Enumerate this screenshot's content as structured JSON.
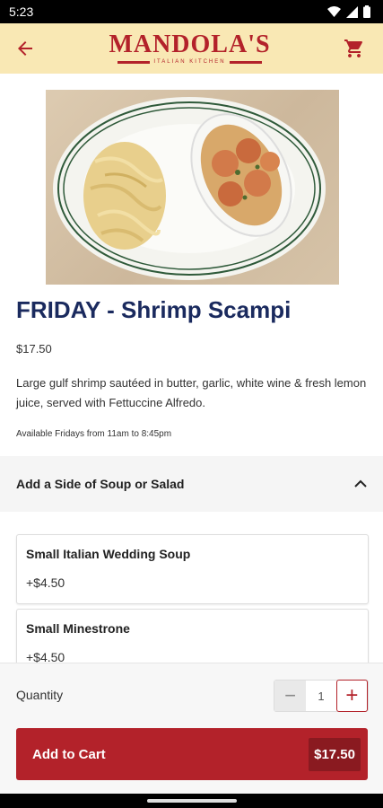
{
  "status_bar": {
    "time": "5:23"
  },
  "app_bar": {
    "brand_name": "MANDOLA'S",
    "brand_tagline": "ITALIAN KITCHEN",
    "back_icon": "arrow-left-icon",
    "cart_icon": "shopping-cart-icon"
  },
  "item": {
    "image_alt": "Shrimp scampi with fettuccine alfredo",
    "title": "FRIDAY - Shrimp Scampi",
    "price": "$17.50",
    "description": "Large gulf shrimp sautéed in butter, garlic, white wine & fresh lemon juice, served with Fettuccine Alfredo.",
    "availability": "Available Fridays from 11am to 8:45pm"
  },
  "side_section": {
    "title": "Add a Side of Soup or Salad",
    "expanded": true,
    "options": [
      {
        "name": "Small Italian Wedding Soup",
        "price": "+$4.50"
      },
      {
        "name": "Small Minestrone",
        "price": "+$4.50"
      }
    ]
  },
  "order": {
    "quantity_label": "Quantity",
    "quantity": "1",
    "minus_symbol": "−",
    "plus_symbol": "+",
    "add_to_cart_label": "Add to Cart",
    "total": "$17.50"
  },
  "colors": {
    "brand_red": "#b3222a",
    "header_bg": "#f9e8b4",
    "title_navy": "#1a2a5e"
  }
}
